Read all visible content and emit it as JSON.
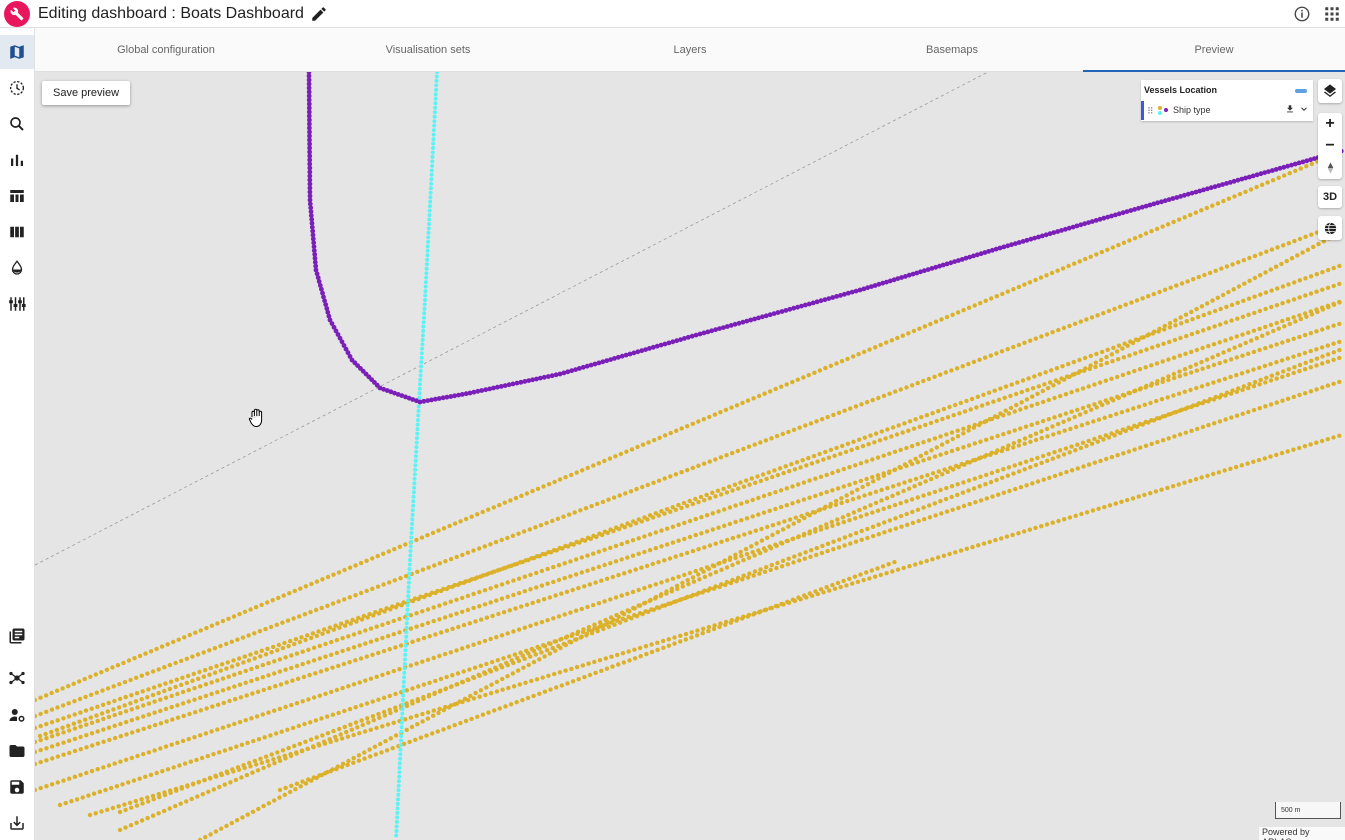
{
  "header": {
    "title": "Editing dashboard : Boats Dashboard"
  },
  "tabs": [
    {
      "label": "Global configuration"
    },
    {
      "label": "Visualisation sets"
    },
    {
      "label": "Layers"
    },
    {
      "label": "Basemaps"
    },
    {
      "label": "Preview"
    }
  ],
  "active_tab": "Preview",
  "map": {
    "save_button": "Save preview",
    "legend": {
      "title": "Vessels Location",
      "layer_label": "Ship type"
    },
    "control_3d": "3D",
    "scale_label": "500 m",
    "attribution": "Powered by ARLAS."
  },
  "colors": {
    "brand": "#e8175d",
    "accent": "#1f64b8",
    "track_purple": "#7a1fb8",
    "track_cyan": "#5ef2f5",
    "track_yellow": "#dcb12a"
  }
}
